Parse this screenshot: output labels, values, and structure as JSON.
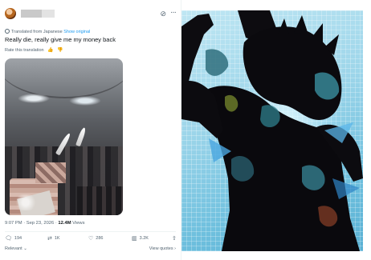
{
  "tweet": {
    "author": {
      "avatar_icon": "avatar-icon",
      "name_redacted": true
    },
    "header_icons": [
      "grok-icon",
      "more-icon"
    ],
    "translated_label": "Translated from Japanese",
    "show_original": "Show original",
    "text": "Really die, really give me my money back",
    "rate_label": "Rate this translation",
    "time": "9:07 PM",
    "date": "Sep 23, 2026",
    "views_count": "12.4M",
    "views_label": "Views",
    "actions": {
      "reply": "194",
      "retweet": "1K",
      "like": "286",
      "views": "3.2K"
    },
    "sort_label": "Relevant",
    "view_quotes": "View quotes"
  },
  "colors": {
    "link": "#1d9bf0",
    "secondary_text": "#536471",
    "primary_text": "#0f1419",
    "photo_background": "#9ed6ea"
  }
}
